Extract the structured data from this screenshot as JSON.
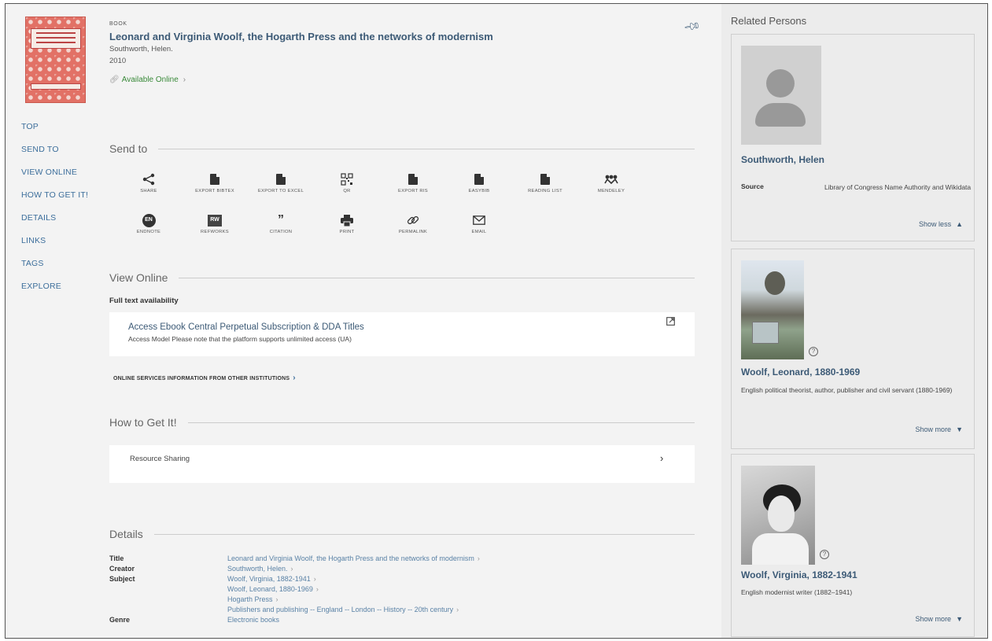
{
  "record": {
    "type": "BOOK",
    "title": "Leonard and Virginia Woolf, the Hogarth Press and the networks of modernism",
    "author": "Southworth, Helen.",
    "year": "2010",
    "availability": "Available Online",
    "availability_color": "#3a8a3a"
  },
  "left_nav": [
    "TOP",
    "SEND TO",
    "VIEW ONLINE",
    "HOW TO GET IT!",
    "DETAILS",
    "LINKS",
    "TAGS",
    "EXPLORE"
  ],
  "send_to": {
    "heading": "Send to",
    "row1": [
      {
        "label": "SHARE",
        "icon": "share-icon"
      },
      {
        "label": "EXPORT BIBTEX",
        "icon": "document-icon"
      },
      {
        "label": "EXPORT TO EXCEL",
        "icon": "excel-icon"
      },
      {
        "label": "QR",
        "icon": "qr-icon"
      },
      {
        "label": "EXPORT RIS",
        "icon": "document-icon"
      },
      {
        "label": "EASYBIB",
        "icon": "document-icon"
      },
      {
        "label": "READING LIST",
        "icon": "document-icon"
      },
      {
        "label": "MENDELEY",
        "icon": "mendeley-icon"
      }
    ],
    "row2": [
      {
        "label": "ENDNOTE",
        "icon": "endnote-icon"
      },
      {
        "label": "REFWORKS",
        "icon": "refworks-icon"
      },
      {
        "label": "CITATION",
        "icon": "quote-icon"
      },
      {
        "label": "PRINT",
        "icon": "print-icon"
      },
      {
        "label": "PERMALINK",
        "icon": "link-icon"
      },
      {
        "label": "EMAIL",
        "icon": "email-icon"
      }
    ]
  },
  "view_online": {
    "heading": "View Online",
    "subheading": "Full text availability",
    "service_title": "Access Ebook Central Perpetual Subscription & DDA Titles",
    "service_note": "Access Model Please note that the platform supports unlimited access (UA)",
    "other_institutions": "ONLINE SERVICES INFORMATION FROM OTHER INSTITUTIONS"
  },
  "how_to_get": {
    "heading": "How to Get It!",
    "item": "Resource Sharing"
  },
  "details": {
    "heading": "Details",
    "rows": [
      {
        "key": "Title",
        "values": [
          "Leonard and Virginia Woolf, the Hogarth Press and the networks of modernism"
        ]
      },
      {
        "key": "Creator",
        "values": [
          "Southworth, Helen."
        ]
      },
      {
        "key": "Subject",
        "values": [
          "Woolf, Virginia, 1882-1941",
          "Woolf, Leonard, 1880-1969",
          "Hogarth Press",
          "Publishers and publishing -- England -- London -- History -- 20th century"
        ]
      },
      {
        "key": "Genre",
        "values": [
          "Electronic books"
        ]
      }
    ]
  },
  "related": {
    "heading": "Related Persons",
    "persons": [
      {
        "name": "Southworth, Helen",
        "source_label": "Source",
        "source": "Library of Congress Name Authority and Wikidata",
        "toggle": "Show less"
      },
      {
        "name": "Woolf, Leonard, 1880-1969",
        "desc": "English political theorist, author, publisher and civil servant (1880-1969)",
        "toggle": "Show more"
      },
      {
        "name": "Woolf, Virginia, 1882-1941",
        "desc": "English modernist writer (1882–1941)",
        "toggle": "Show more"
      }
    ]
  }
}
